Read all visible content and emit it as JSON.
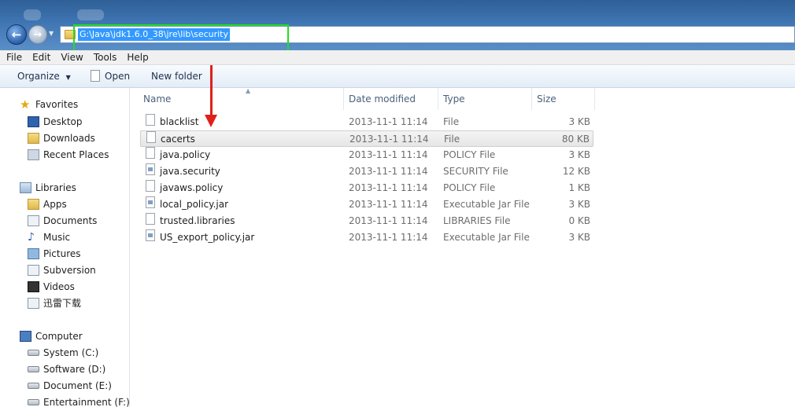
{
  "address": {
    "path": "G:\\Java\\jdk1.6.0_38\\jre\\lib\\security"
  },
  "menu": [
    "File",
    "Edit",
    "View",
    "Tools",
    "Help"
  ],
  "toolbar": {
    "organize": "Organize",
    "open": "Open",
    "new_folder": "New folder"
  },
  "nav": {
    "favorites": {
      "label": "Favorites",
      "items": [
        "Desktop",
        "Downloads",
        "Recent Places"
      ]
    },
    "libraries": {
      "label": "Libraries",
      "items": [
        "Apps",
        "Documents",
        "Music",
        "Pictures",
        "Subversion",
        "Videos",
        "迅雷下载"
      ]
    },
    "computer": {
      "label": "Computer",
      "items": [
        "System (C:)",
        "Software (D:)",
        "Document (E:)",
        "Entertainment (F:)"
      ]
    }
  },
  "columns": {
    "name": "Name",
    "date": "Date modified",
    "type": "Type",
    "size": "Size"
  },
  "files": [
    {
      "name": "blacklist",
      "date": "2013-11-1 11:14",
      "type": "File",
      "size": "3 KB"
    },
    {
      "name": "cacerts",
      "date": "2013-11-1 11:14",
      "type": "File",
      "size": "80 KB"
    },
    {
      "name": "java.policy",
      "date": "2013-11-1 11:14",
      "type": "POLICY File",
      "size": "3 KB"
    },
    {
      "name": "java.security",
      "date": "2013-11-1 11:14",
      "type": "SECURITY File",
      "size": "12 KB"
    },
    {
      "name": "javaws.policy",
      "date": "2013-11-1 11:14",
      "type": "POLICY File",
      "size": "1 KB"
    },
    {
      "name": "local_policy.jar",
      "date": "2013-11-1 11:14",
      "type": "Executable Jar File",
      "size": "3 KB"
    },
    {
      "name": "trusted.libraries",
      "date": "2013-11-1 11:14",
      "type": "LIBRARIES File",
      "size": "0 KB"
    },
    {
      "name": "US_export_policy.jar",
      "date": "2013-11-1 11:14",
      "type": "Executable Jar File",
      "size": "3 KB"
    }
  ],
  "colors": {
    "selection": "#3399ff",
    "highlight_box": "#22dd22",
    "arrow": "#e0201a"
  }
}
